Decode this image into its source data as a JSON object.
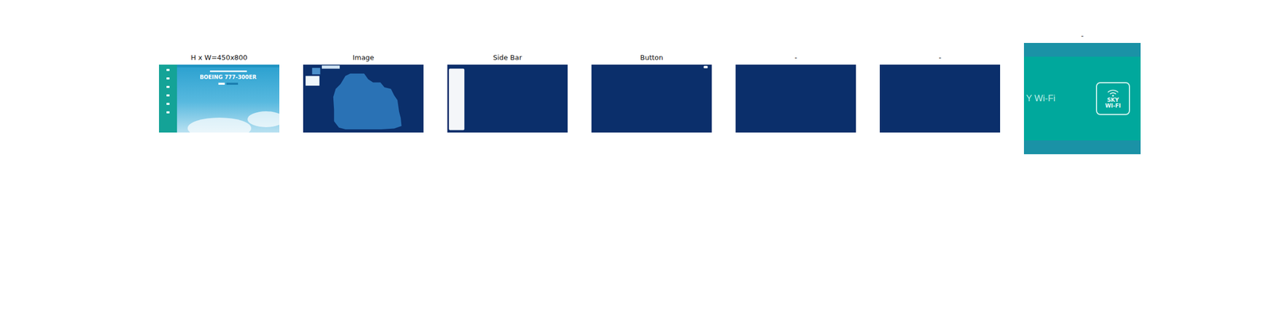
{
  "panels": [
    {
      "title": "H x W=450x800",
      "kind": "screenshot",
      "headline": "BOEING 777-300ER"
    },
    {
      "title": "Image",
      "kind": "mask-image"
    },
    {
      "title": "Side Bar",
      "kind": "mask-sidebar"
    },
    {
      "title": "Button",
      "kind": "mask-button"
    },
    {
      "title": "-",
      "kind": "mask-empty"
    },
    {
      "title": "-",
      "kind": "mask-empty"
    },
    {
      "title": "-",
      "kind": "crop",
      "caption": "Y Wi-Fi",
      "badge": "SKY WI-FI"
    }
  ]
}
